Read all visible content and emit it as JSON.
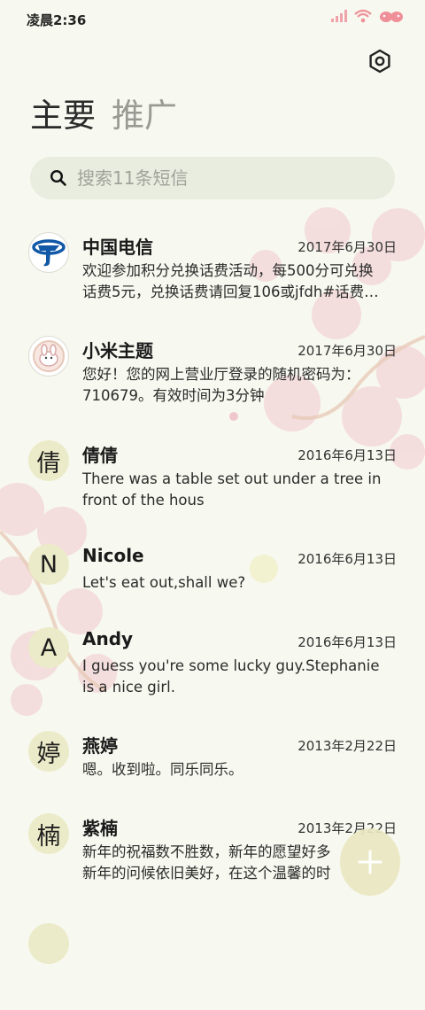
{
  "status_bar": {
    "time": "凌晨2:36"
  },
  "tabs": [
    {
      "label": "主要",
      "active": true
    },
    {
      "label": "推广",
      "active": false
    }
  ],
  "search": {
    "placeholder": "搜索11条短信"
  },
  "messages": [
    {
      "sender": "中国电信",
      "date": "2017年6月30日",
      "avatar_type": "telecom-logo",
      "preview": [
        "欢迎参加积分兑换话费活动，每500分可兑换",
        "话费5元，兑换话费请回复106或jfdh#话费…"
      ]
    },
    {
      "sender": "小米主题",
      "date": "2017年6月30日",
      "avatar_type": "theme-logo",
      "preview": [
        "您好！您的网上营业厅登录的随机密码为：",
        "710679。有效时间为3分钟"
      ]
    },
    {
      "sender": "倩倩",
      "date": "2016年6月13日",
      "avatar": "倩",
      "preview": [
        "There was a table set out under a tree in",
        "front of the hous"
      ]
    },
    {
      "sender": "Nicole",
      "date": "2016年6月13日",
      "avatar": "N",
      "preview": [
        "Let's eat out,shall we?"
      ]
    },
    {
      "sender": "Andy",
      "date": "2016年6月13日",
      "avatar": "A",
      "preview": [
        "I guess you're some lucky guy.Stephanie",
        "is a nice girl."
      ]
    },
    {
      "sender": "燕婷",
      "date": "2013年2月22日",
      "avatar": "婷",
      "preview": [
        "嗯。收到啦。同乐同乐。"
      ]
    },
    {
      "sender": "紫楠",
      "date": "2013年2月22日",
      "avatar": "楠",
      "preview": [
        "新年的祝福数不胜数，新年的愿望好多",
        "新年的问候依旧美好，在这个温馨的时"
      ]
    }
  ],
  "colors": {
    "accent_avatar_bg": "#ecebc9",
    "background": "#f7f8ef",
    "search_bg": "#e8eddf",
    "blossom": "#f2d6d8"
  }
}
